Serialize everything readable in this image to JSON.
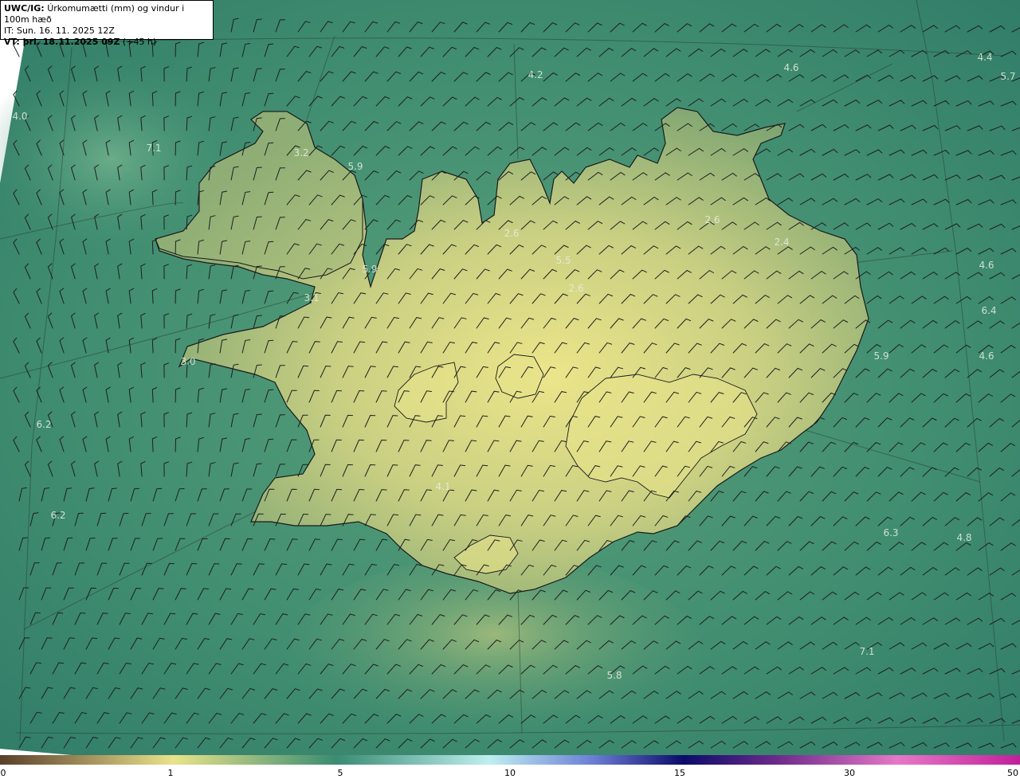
{
  "header": {
    "code": "UWC/IG:",
    "title": "Úrkomumætti (mm) og vindur i 100m hæð",
    "it_line": "IT: Sun. 16. 11. 2025 12Z",
    "vt_prefix": "VT: þri. 18.11.2025 09Z",
    "vt_suffix": " (+45 h)"
  },
  "colors": {
    "ocean": "#3d8a70",
    "land_low": "#7aa070",
    "land_high": "#e6e48a",
    "coast": "#1a1a1a",
    "barb": "#1f1f1f"
  },
  "colorbar": {
    "ticks": [
      "0",
      "1",
      "5",
      "10",
      "15",
      "30",
      "50"
    ],
    "stops": [
      "#5a3f2a",
      "#9e8a5a",
      "#e9e38a",
      "#3a8c72",
      "#bfeff0",
      "#6d7fd6",
      "#0b0b6a",
      "#6a2a8a",
      "#e678c8",
      "#c0209a"
    ]
  },
  "map": {
    "labels": [
      {
        "text": "4.0"
      },
      {
        "text": "7.1"
      },
      {
        "text": "3.2"
      },
      {
        "text": "5.9"
      },
      {
        "text": "4.2"
      },
      {
        "text": "4.6"
      },
      {
        "text": "4.4"
      },
      {
        "text": "5.7"
      },
      {
        "text": "2.6"
      },
      {
        "text": "2.6"
      },
      {
        "text": "5.5"
      },
      {
        "text": "2.4"
      },
      {
        "text": "5.9"
      },
      {
        "text": "2.6"
      },
      {
        "text": "3.1"
      },
      {
        "text": "4.6"
      },
      {
        "text": "6.4"
      },
      {
        "text": "3.0"
      },
      {
        "text": "5.9"
      },
      {
        "text": "4.6"
      },
      {
        "text": "6.2"
      },
      {
        "text": "4.1"
      },
      {
        "text": "6.2"
      },
      {
        "text": "6.3"
      },
      {
        "text": "4.8"
      },
      {
        "text": "7.1"
      },
      {
        "text": "5.8"
      }
    ]
  }
}
